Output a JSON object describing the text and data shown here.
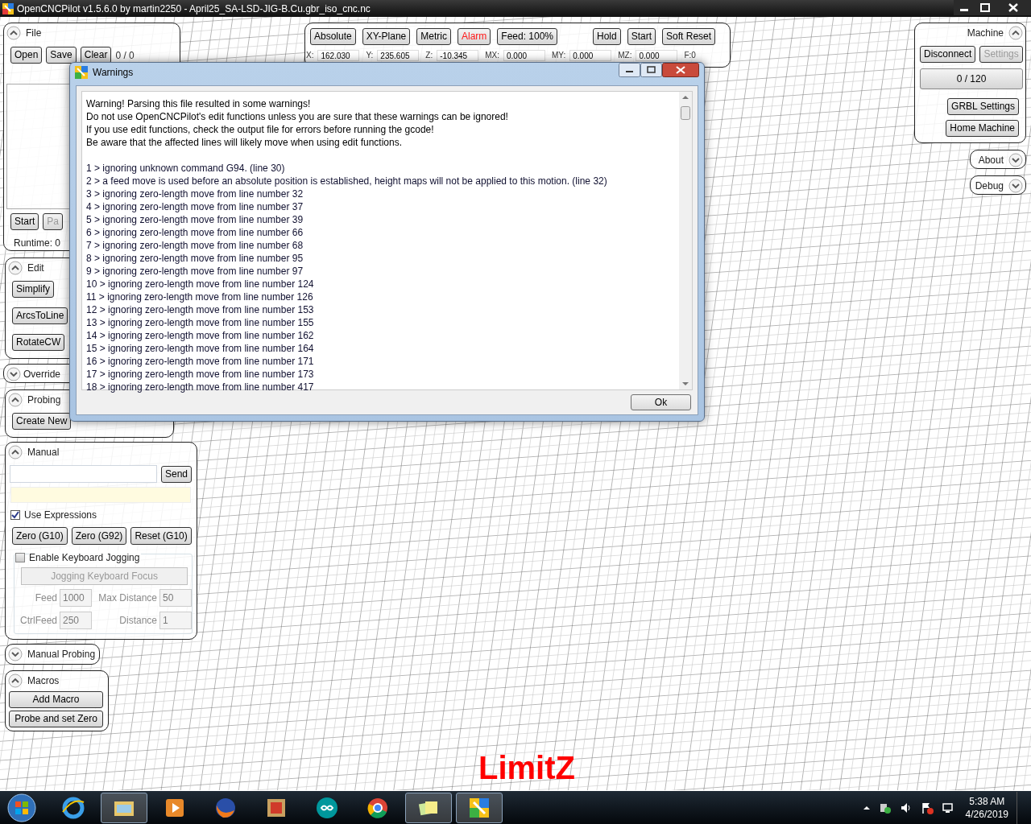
{
  "window": {
    "title": "OpenCNCPilot v1.5.6.0 by martin2250 - April25_SA-LSD-JIG-B.Cu.gbr_iso_cnc.nc"
  },
  "file_panel": {
    "title": "File",
    "expanded": true,
    "buttons": [
      "Open",
      "Save",
      "Clear"
    ],
    "count": "0 / 0",
    "run_buttons": [
      {
        "label": "Start",
        "disabled": false
      },
      {
        "label": "Pa",
        "disabled": true
      }
    ],
    "runtime": "Runtime: 0"
  },
  "edit_panel": {
    "title": "Edit",
    "expanded": true,
    "buttons": [
      "Simplify",
      "ArcsToLine",
      "RotateCW"
    ]
  },
  "override_panel": {
    "title": "Override",
    "expanded": false
  },
  "probing_panel": {
    "title": "Probing",
    "expanded": true,
    "buttons": [
      "Create New"
    ]
  },
  "toolbar": {
    "buttons": [
      {
        "label": "Absolute",
        "alert": false
      },
      {
        "label": "XY-Plane",
        "alert": false
      },
      {
        "label": "Metric",
        "alert": false
      },
      {
        "label": "Alarm",
        "alert": true
      },
      {
        "label": "Feed: 100%",
        "alert": false
      }
    ],
    "control_buttons": [
      "Hold",
      "Start",
      "Soft Reset"
    ],
    "positions": [
      {
        "label": "X:",
        "value": "162.030"
      },
      {
        "label": "Y:",
        "value": "235.605"
      },
      {
        "label": "Z:",
        "value": "-10.345"
      },
      {
        "label": "MX:",
        "value": "0.000"
      },
      {
        "label": "MY:",
        "value": "0.000"
      },
      {
        "label": "MZ:",
        "value": "0.000"
      }
    ],
    "feed": "F:0"
  },
  "manual_panel": {
    "title": "Manual",
    "expanded": true,
    "send_button": "Send",
    "use_expressions": {
      "label": "Use Expressions",
      "checked": true
    },
    "zero_buttons": [
      "Zero (G10)",
      "Zero (G92)",
      "Reset (G10)"
    ],
    "keyboard_jogging": {
      "label": "Enable Keyboard Jogging",
      "checked": false,
      "focus_button": "Jogging Keyboard Focus",
      "fields": [
        {
          "label": "Feed",
          "value": "1000"
        },
        {
          "label": "Max Distance",
          "value": "50"
        },
        {
          "label": "CtrlFeed",
          "value": "250"
        },
        {
          "label": "Distance",
          "value": "1"
        }
      ]
    }
  },
  "manual_probing_panel": {
    "title": "Manual Probing",
    "expanded": false
  },
  "macros_panel": {
    "title": "Macros",
    "expanded": true,
    "buttons": [
      "Add Macro",
      "Probe and set Zero"
    ]
  },
  "machine_panel": {
    "title": "Machine",
    "expanded": true,
    "buttons": [
      {
        "label": "Disconnect",
        "disabled": false
      },
      {
        "label": "Settings",
        "disabled": true
      }
    ],
    "buffer": "0 / 120",
    "grbl_settings": "GRBL Settings",
    "home_machine": "Home Machine"
  },
  "about_panel": {
    "title": "About",
    "expanded": false
  },
  "debug_panel": {
    "title": "Debug",
    "expanded": false
  },
  "overlay_label": "LimitZ",
  "dialog": {
    "title": "Warnings",
    "intro": [
      "Warning! Parsing this file resulted in some warnings!",
      "Do not use OpenCNCPilot's edit functions unless you are sure that these warnings can be ignored!",
      "If you use edit functions, check the output file for errors before running the gcode!",
      "Be aware that the affected lines will likely move when using edit functions."
    ],
    "warnings": [
      "1 > ignoring unknown command G94. (line 30)",
      "2 > a feed move is used before an absolute position is established, height maps will not be applied to this motion. (line 32)",
      "3 > ignoring zero-length move from line number 32",
      "4 > ignoring zero-length move from line number 37",
      "5 > ignoring zero-length move from line number 39",
      "6 > ignoring zero-length move from line number 66",
      "7 > ignoring zero-length move from line number 68",
      "8 > ignoring zero-length move from line number 95",
      "9 > ignoring zero-length move from line number 97",
      "10 > ignoring zero-length move from line number 124",
      "11 > ignoring zero-length move from line number 126",
      "12 > ignoring zero-length move from line number 153",
      "13 > ignoring zero-length move from line number 155",
      "14 > ignoring zero-length move from line number 162",
      "15 > ignoring zero-length move from line number 164",
      "16 > ignoring zero-length move from line number 171",
      "17 > ignoring zero-length move from line number 173",
      "18 > ignoring zero-length move from line number 417"
    ],
    "ok_button": "Ok"
  },
  "taskbar": {
    "time": "5:38 AM",
    "date": "4/26/2019"
  }
}
